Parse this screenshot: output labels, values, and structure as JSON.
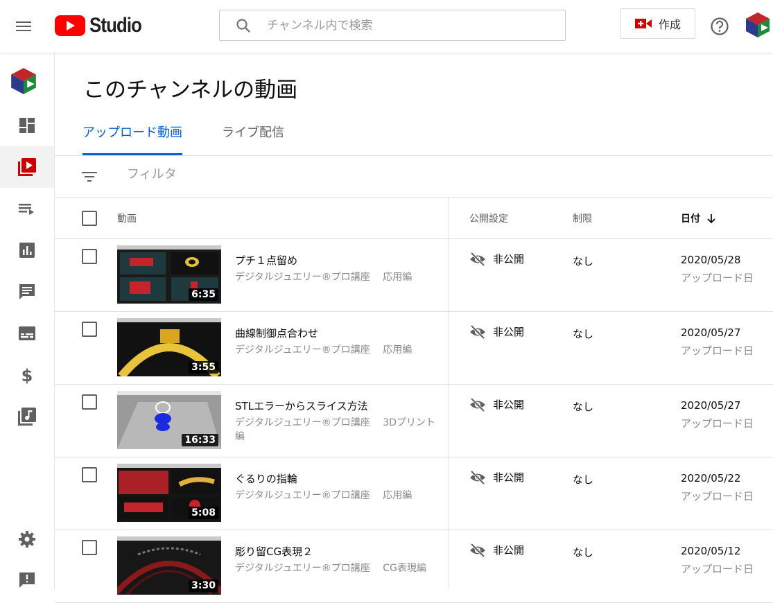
{
  "header": {
    "logo_text": "Studio",
    "search_placeholder": "チャンネル内で検索",
    "create_label": "作成"
  },
  "page": {
    "title": "このチャンネルの動画",
    "tabs": [
      {
        "label": "アップロード動画",
        "active": true
      },
      {
        "label": "ライブ配信",
        "active": false
      }
    ],
    "filter_placeholder": "フィルタ"
  },
  "sidebar": {
    "items": [
      {
        "name": "dashboard",
        "icon": "dashboard-icon",
        "active": false
      },
      {
        "name": "videos",
        "icon": "video-library-icon",
        "active": true
      },
      {
        "name": "playlists",
        "icon": "playlist-icon",
        "active": false
      },
      {
        "name": "analytics",
        "icon": "analytics-icon",
        "active": false
      },
      {
        "name": "comments",
        "icon": "comments-icon",
        "active": false
      },
      {
        "name": "subtitles",
        "icon": "subtitles-icon",
        "active": false
      },
      {
        "name": "monetization",
        "icon": "dollar-icon",
        "active": false
      },
      {
        "name": "audio-library",
        "icon": "audio-library-icon",
        "active": false
      },
      {
        "name": "settings",
        "icon": "gear-icon",
        "active": false
      },
      {
        "name": "feedback",
        "icon": "feedback-icon",
        "active": false
      }
    ]
  },
  "table": {
    "headers": {
      "video": "動画",
      "visibility": "公開設定",
      "restrictions": "制限",
      "date": "日付"
    },
    "rows": [
      {
        "title": "プチ１点留め",
        "description": "デジタルジュエリー®プロ講座　 応用編",
        "duration": "6:35",
        "visibility": "非公開",
        "restrictions": "なし",
        "date": "2020/05/28",
        "date_type": "アップロード日",
        "thumb": "split-red"
      },
      {
        "title": "曲線制御点合わせ",
        "description": "デジタルジュエリー®プロ講座　 応用編",
        "duration": "3:55",
        "visibility": "非公開",
        "restrictions": "なし",
        "date": "2020/05/27",
        "date_type": "アップロード日",
        "thumb": "gold-ring"
      },
      {
        "title": "STLエラーからスライス方法",
        "description": "デジタルジュエリー®プロ講座　 3Dプリント編",
        "duration": "16:33",
        "visibility": "非公開",
        "restrictions": "なし",
        "date": "2020/05/27",
        "date_type": "アップロード日",
        "thumb": "slicer"
      },
      {
        "title": "ぐるりの指輪",
        "description": "デジタルジュエリー®プロ講座　 応用編",
        "duration": "5:08",
        "visibility": "非公開",
        "restrictions": "なし",
        "date": "2020/05/22",
        "date_type": "アップロード日",
        "thumb": "split-red-gold"
      },
      {
        "title": "彫り留CG表現２",
        "description": "デジタルジュエリー®プロ講座　 CG表現編",
        "duration": "3:30",
        "visibility": "非公開",
        "restrictions": "なし",
        "date": "2020/05/12",
        "date_type": "アップロード日",
        "thumb": "dark-ring"
      }
    ]
  },
  "colors": {
    "accent": "#065fd4",
    "youtube_red": "#ff0000",
    "icon_gray": "#606060"
  }
}
